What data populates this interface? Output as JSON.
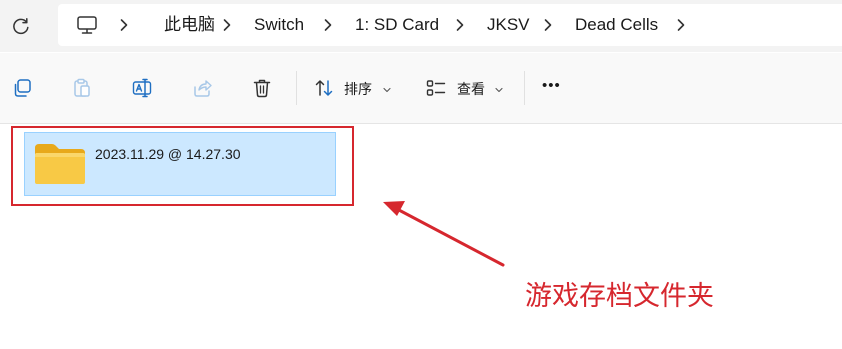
{
  "address_bar": {
    "breadcrumbs": [
      {
        "label": "此电脑"
      },
      {
        "label": "Switch"
      },
      {
        "label": "1: SD Card"
      },
      {
        "label": "JKSV"
      },
      {
        "label": "Dead Cells"
      }
    ],
    "root_icon": "computer-icon"
  },
  "toolbar": {
    "buttons": [
      {
        "icon": "copy-icon",
        "enabled": true
      },
      {
        "icon": "paste-icon",
        "enabled": false
      },
      {
        "icon": "rename-icon",
        "enabled": true
      },
      {
        "icon": "share-icon",
        "enabled": false
      },
      {
        "icon": "delete-icon",
        "enabled": true
      }
    ],
    "sort_label": "排序",
    "view_label": "查看",
    "more_label": "•••"
  },
  "content": {
    "items": [
      {
        "name": "2023.11.29 @ 14.27.30",
        "type": "folder",
        "selected": true
      }
    ]
  },
  "annotation": {
    "text": "游戏存档文件夹",
    "color": "#d6272e"
  },
  "colors": {
    "selection_bg": "#cce8ff",
    "selection_border": "#99d1ff",
    "folder_yellow": "#f8c945",
    "annotation_red": "#d6272e"
  }
}
